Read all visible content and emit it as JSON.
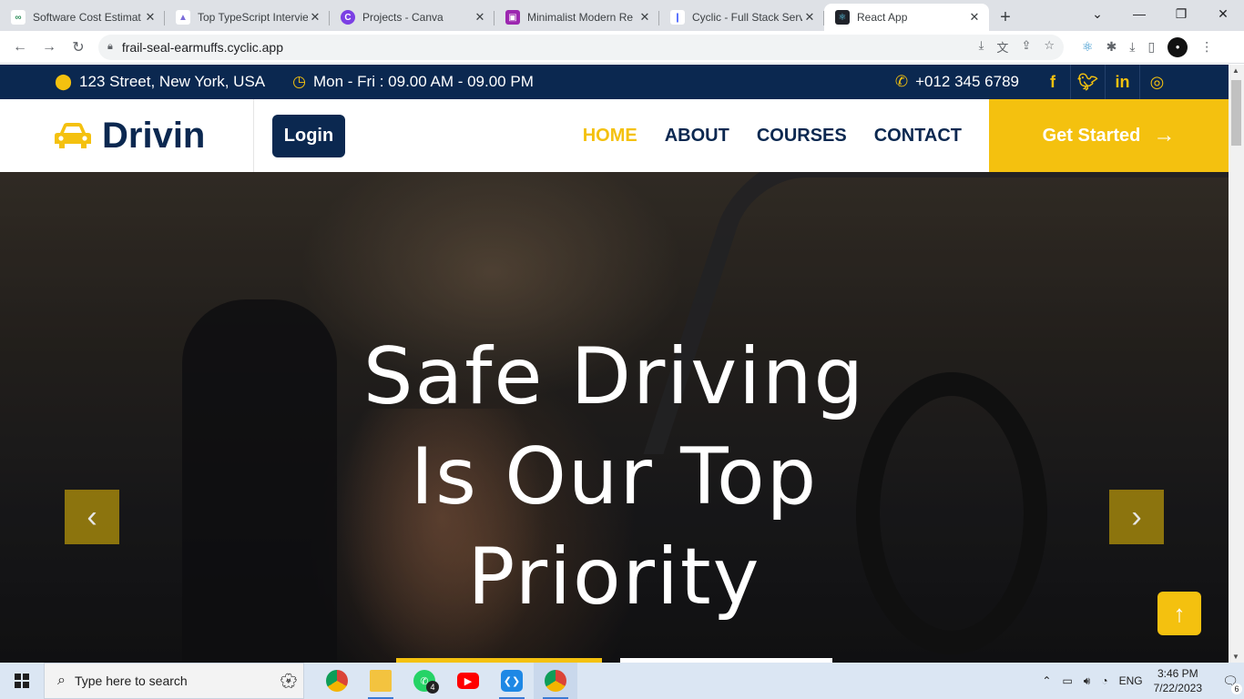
{
  "browser": {
    "tabs": [
      {
        "label": "Software Cost Estimat",
        "favicon": "gcc-icon",
        "color": "#2f8f5b",
        "active": false
      },
      {
        "label": "Top TypeScript Intervie",
        "favicon": "chart-icon",
        "color": "#7b6cd9",
        "active": false
      },
      {
        "label": "Projects - Canva",
        "favicon": "canva-icon",
        "color": "#7b3fe4",
        "active": false
      },
      {
        "label": "Minimalist Modern Re",
        "favicon": "figma-icon",
        "color": "#9c27b0",
        "active": false
      },
      {
        "label": "Cyclic - Full Stack Serv",
        "favicon": "cyclic-icon",
        "color": "#3d5afe",
        "active": false
      },
      {
        "label": "React App",
        "favicon": "react-icon",
        "color": "#20232a",
        "active": true
      }
    ],
    "url": "frail-seal-earmuffs.cyclic.app"
  },
  "topbar": {
    "address": "123 Street, New York, USA",
    "hours": "Mon - Fri : 09.00 AM - 09.00 PM",
    "phone": "+012 345 6789",
    "social": [
      "facebook-icon",
      "twitter-icon",
      "linkedin-icon",
      "instagram-icon"
    ]
  },
  "navbar": {
    "brand": "Drivin",
    "login_label": "Login",
    "menu": [
      "HOME",
      "ABOUT",
      "COURSES",
      "CONTACT"
    ],
    "active_menu": "HOME",
    "cta_label": "Get Started"
  },
  "hero": {
    "title_line1": "Safe Driving",
    "title_line2": "Is Our Top",
    "title_line3": "Priority"
  },
  "colors": {
    "primary": "#0b2850",
    "accent": "#f4c10f"
  },
  "taskbar": {
    "search_placeholder": "Type here to search",
    "whatsapp_badge": "4",
    "language": "ENG",
    "time": "3:46 PM",
    "date": "7/22/2023",
    "notifications": "6"
  }
}
